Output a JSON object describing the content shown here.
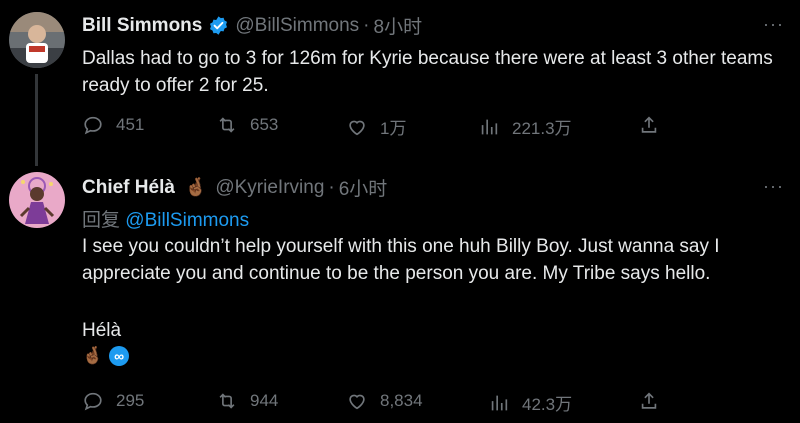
{
  "tweet1": {
    "name": "Bill Simmons",
    "handle": "@BillSimmons",
    "dot": "·",
    "time": "8小时",
    "text": "Dallas had to go to 3 for 126m for Kyrie because there were at least 3 other teams ready to offer 2 for 25.",
    "actions": {
      "replies": "451",
      "retweets": "653",
      "likes": "1万",
      "views": "221.3万"
    }
  },
  "tweet2": {
    "name": "Chief Hélà",
    "handle": "@KyrieIrving",
    "dot": "·",
    "time": "6小时",
    "reply_label": "回复",
    "reply_handle": "@BillSimmons",
    "text": "I see you couldn’t help yourself with this one huh Billy Boy. Just wanna say I appreciate you and continue to be the person you are. My Tribe says hello.",
    "signature": "Hélà",
    "actions": {
      "replies": "295",
      "retweets": "944",
      "likes": "8,834",
      "views": "42.3万"
    }
  },
  "icons": {
    "more": "···",
    "fingers": "🤞🏾",
    "infinity": "∞"
  },
  "colors": {
    "background": "#000000",
    "text": "#e7e9ea",
    "muted": "#71767b",
    "accent": "#1d9bf0"
  }
}
